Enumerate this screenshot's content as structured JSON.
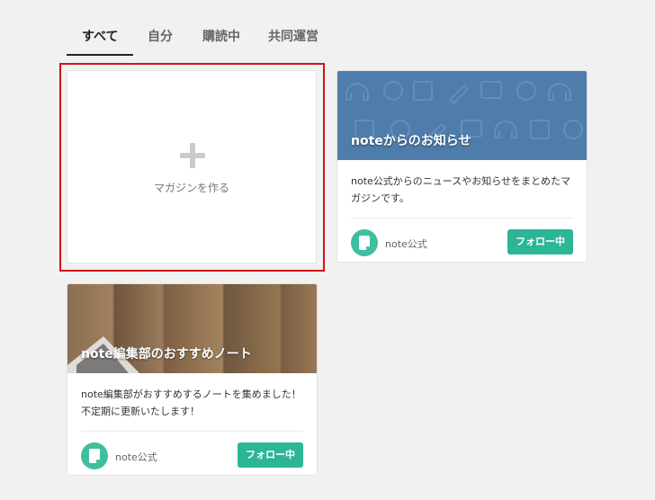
{
  "tabs": [
    {
      "label": "すべて",
      "active": true
    },
    {
      "label": "自分"
    },
    {
      "label": "購読中"
    },
    {
      "label": "共同運営"
    }
  ],
  "create_card": {
    "label": "マガジンを作る",
    "icon": "plus-icon"
  },
  "magazines": [
    {
      "title": "noteからのお知らせ",
      "description": "note公式からのニュースやお知らせをまとめたマガジンです。",
      "author": "note公式",
      "follow_label": "フォロー中",
      "cover_color": "#4f7dab"
    },
    {
      "title": "note編集部のおすすめノート",
      "description": "note編集部がおすすめするノートを集めました！不定期に更新いたします！",
      "author": "note公式",
      "follow_label": "フォロー中",
      "cover": "wood-texture"
    }
  ],
  "colors": {
    "accent": "#2cb696",
    "avatar": "#3fbf9f",
    "highlight": "#d0141c"
  }
}
